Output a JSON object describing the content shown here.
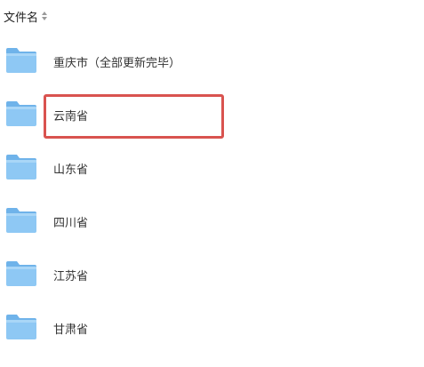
{
  "header": {
    "column_label": "文件名"
  },
  "colors": {
    "folder_body": "#8ec8f4",
    "folder_tab": "#6fb3ea",
    "highlight": "#d9534f"
  },
  "files": [
    {
      "name": "重庆市（全部更新完毕）",
      "icon": "folder-icon"
    },
    {
      "name": "云南省",
      "icon": "folder-icon",
      "highlighted": true
    },
    {
      "name": "山东省",
      "icon": "folder-icon"
    },
    {
      "name": "四川省",
      "icon": "folder-icon"
    },
    {
      "name": "江苏省",
      "icon": "folder-icon"
    },
    {
      "name": "甘肃省",
      "icon": "folder-icon"
    }
  ]
}
